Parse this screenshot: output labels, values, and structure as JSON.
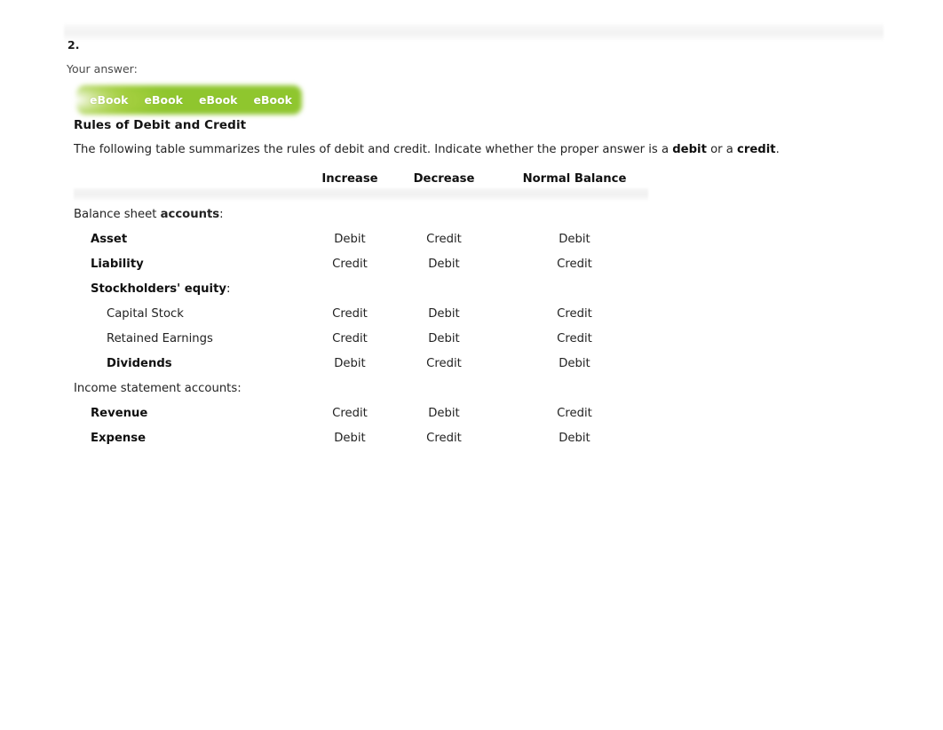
{
  "question": {
    "number": "2.",
    "your_answer_label": "Your answer:"
  },
  "ebook_links": [
    {
      "label": "eBook"
    },
    {
      "label": "eBook"
    },
    {
      "label": "eBook"
    },
    {
      "label": "eBook"
    }
  ],
  "heading": "Rules of Debit and Credit",
  "intro": {
    "part1": "The following table summarizes the rules of debit and credit. Indicate whether the proper answer is a ",
    "bold1": "debit",
    "part2": " or a ",
    "bold2": "credit",
    "part3": "."
  },
  "table": {
    "headers": {
      "increase": "Increase",
      "decrease": "Decrease",
      "normal_balance": "Normal Balance"
    },
    "sections": [
      {
        "title_plain": "Balance sheet ",
        "title_bold": "accounts",
        "title_suffix": ":",
        "rows": [
          {
            "label": "Asset",
            "bold": true,
            "indent": 1,
            "increase": "Debit",
            "decrease": "Credit",
            "normal": "Debit"
          },
          {
            "label": "Liability",
            "bold": true,
            "indent": 1,
            "increase": "Credit",
            "decrease": "Debit",
            "normal": "Credit"
          },
          {
            "label": "Stockholders' equity",
            "bold": true,
            "indent": 1,
            "suffix": ":",
            "increase": "",
            "decrease": "",
            "normal": ""
          },
          {
            "label": "Capital Stock",
            "bold": false,
            "indent": 2,
            "increase": "Credit",
            "decrease": "Debit",
            "normal": "Credit"
          },
          {
            "label": "Retained Earnings",
            "bold": false,
            "indent": 2,
            "increase": "Credit",
            "decrease": "Debit",
            "normal": "Credit"
          },
          {
            "label": "Dividends",
            "bold": true,
            "indent": 2,
            "increase": "Debit",
            "decrease": "Credit",
            "normal": "Debit"
          }
        ]
      },
      {
        "title_plain": "Income statement accounts",
        "title_bold": "",
        "title_suffix": ":",
        "rows": [
          {
            "label": "Revenue",
            "bold": true,
            "indent": 1,
            "increase": "Credit",
            "decrease": "Debit",
            "normal": "Credit"
          },
          {
            "label": "Expense",
            "bold": true,
            "indent": 1,
            "increase": "Debit",
            "decrease": "Credit",
            "normal": "Debit"
          }
        ]
      }
    ]
  },
  "colors": {
    "ebook_green": "#8FC62E",
    "ebook_green_light": "#cde287",
    "text": "#232323",
    "band_gray": "#f2f2f2"
  }
}
